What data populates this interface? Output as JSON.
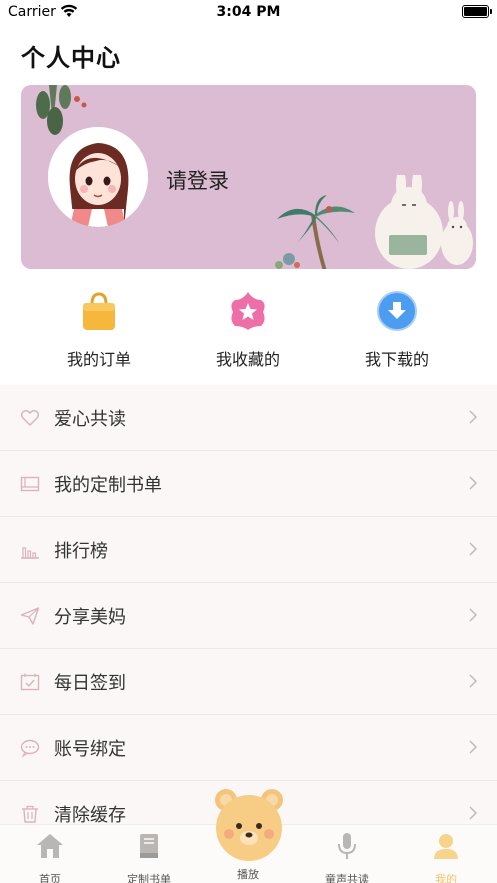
{
  "status_bar": {
    "carrier": "Carrier",
    "time": "3:04 PM"
  },
  "page_title": "个人中心",
  "profile": {
    "login_text": "请登录"
  },
  "quick_actions": [
    {
      "label": "我的订单",
      "icon": "shopping-bag-icon",
      "color": "#f5b83d"
    },
    {
      "label": "我收藏的",
      "icon": "star-flower-icon",
      "color": "#ee6fa7"
    },
    {
      "label": "我下载的",
      "icon": "download-icon",
      "color": "#4c9df0"
    }
  ],
  "menu": [
    {
      "label": "爱心共读",
      "icon": "heart-icon"
    },
    {
      "label": "我的定制书单",
      "icon": "list-card-icon"
    },
    {
      "label": "排行榜",
      "icon": "bar-chart-icon"
    },
    {
      "label": "分享美妈",
      "icon": "paper-plane-icon"
    },
    {
      "label": "每日签到",
      "icon": "calendar-check-icon"
    },
    {
      "label": "账号绑定",
      "icon": "chat-bubble-icon"
    },
    {
      "label": "清除缓存",
      "icon": "trash-icon"
    }
  ],
  "tabbar": [
    {
      "label": "首页",
      "icon": "home-icon"
    },
    {
      "label": "定制书单",
      "icon": "book-icon"
    },
    {
      "label": "播放",
      "icon": "bear-icon"
    },
    {
      "label": "童声共读",
      "icon": "microphone-icon"
    },
    {
      "label": "我的",
      "icon": "person-icon",
      "active": true
    }
  ],
  "colors": {
    "accent": "#f3c46b",
    "card_bg": "#dcbcd2",
    "menu_icon": "#d9b4bb"
  }
}
